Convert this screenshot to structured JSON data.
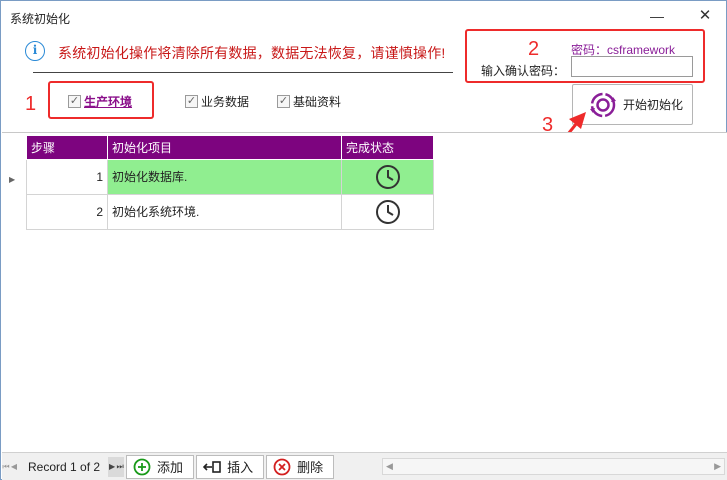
{
  "window": {
    "title": "系统初始化",
    "minimize_glyph": "—",
    "close_glyph": "✕"
  },
  "notice": {
    "icon": "info-icon",
    "icon_glyph": "i",
    "text": "系统初始化操作将清除所有数据，数据无法恢复，请谨慎操作!"
  },
  "options": [
    {
      "label": "生产环境",
      "checked": true
    },
    {
      "label": "业务数据",
      "checked": true
    },
    {
      "label": "基础资料",
      "checked": true
    }
  ],
  "password": {
    "hint": "密码：csframework",
    "label": "输入确认密码：",
    "value": ""
  },
  "start_button": {
    "label": "开始初始化",
    "icon": "refresh-circle-icon"
  },
  "annotations": {
    "n1": "1",
    "n2": "2",
    "n3": "3",
    "color": "#ee2b2b"
  },
  "grid": {
    "columns": [
      "步骤",
      "初始化项目",
      "完成状态"
    ],
    "rows": [
      {
        "step": "1",
        "item": "初始化数据库.",
        "status_icon": "clock-icon",
        "selected": true
      },
      {
        "step": "2",
        "item": "初始化系统环境.",
        "status_icon": "clock-icon",
        "selected": false
      }
    ],
    "header_color": "#7d047f",
    "selected_color": "#90ee90"
  },
  "navigator": {
    "record_text": "Record 1 of 2",
    "buttons": [
      {
        "label": "添加",
        "icon": "add-icon"
      },
      {
        "label": "插入",
        "icon": "insert-icon"
      },
      {
        "label": "删除",
        "icon": "delete-icon"
      }
    ]
  }
}
